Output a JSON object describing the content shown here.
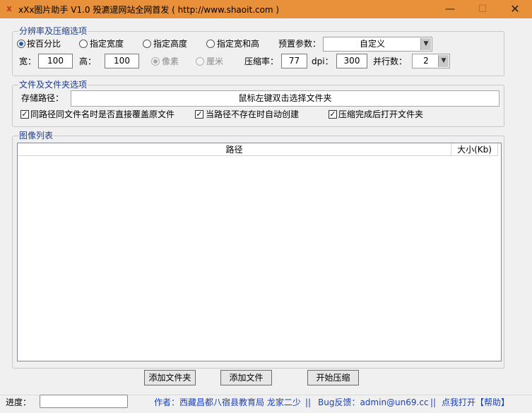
{
  "window": {
    "title": "xXx图片助手 V1.0  殁瀌遈网站全网首发 ( http://www.shaoit.com )",
    "icon": "x",
    "min_glyph": "—",
    "max_glyph": "☐",
    "close_glyph": "✕",
    "accent": "#e8913a"
  },
  "resolution_group": {
    "title": "分辨率及压缩选项",
    "modes": [
      {
        "label": "按百分比",
        "checked": true
      },
      {
        "label": "指定宽度",
        "checked": false
      },
      {
        "label": "指定高度",
        "checked": false
      },
      {
        "label": "指定宽和高",
        "checked": false
      }
    ],
    "preset_label": "预置参数：",
    "preset_value": "自定义",
    "width_label": "宽：",
    "width_value": "100",
    "height_label": "高：",
    "height_value": "100",
    "unit_pixel": "像素",
    "unit_cm": "厘米",
    "compression_label": "压缩率：",
    "compression_value": "77",
    "dpi_label": "dpi：",
    "dpi_value": "300",
    "parallel_label": "并行数：",
    "parallel_value": "2"
  },
  "folder_group": {
    "title": "文件及文件夹选项",
    "path_label": "存储路径：",
    "path_value": "鼠标左键双击选择文件夹",
    "options": [
      {
        "label": "同路径同文件名时是否直接覆盖原文件",
        "checked": true
      },
      {
        "label": "当路径不存在时自动创建",
        "checked": true
      },
      {
        "label": "压缩完成后打开文件夹",
        "checked": true
      }
    ]
  },
  "image_list": {
    "title": "图像列表",
    "columns": [
      "路径",
      "大小(Kb)"
    ]
  },
  "buttons": {
    "add_folder": "添加文件夹",
    "add_file": "添加文件",
    "start": "开始压缩"
  },
  "status": {
    "progress_label": "进度：",
    "progress_value": 0,
    "author": "作者：西藏昌都八宿县教育局 龙家二少",
    "sep1": "||",
    "bug_feedback": "Bug反馈：admin@un69.cc",
    "sep2": "||",
    "help": "点我打开【帮助】"
  }
}
